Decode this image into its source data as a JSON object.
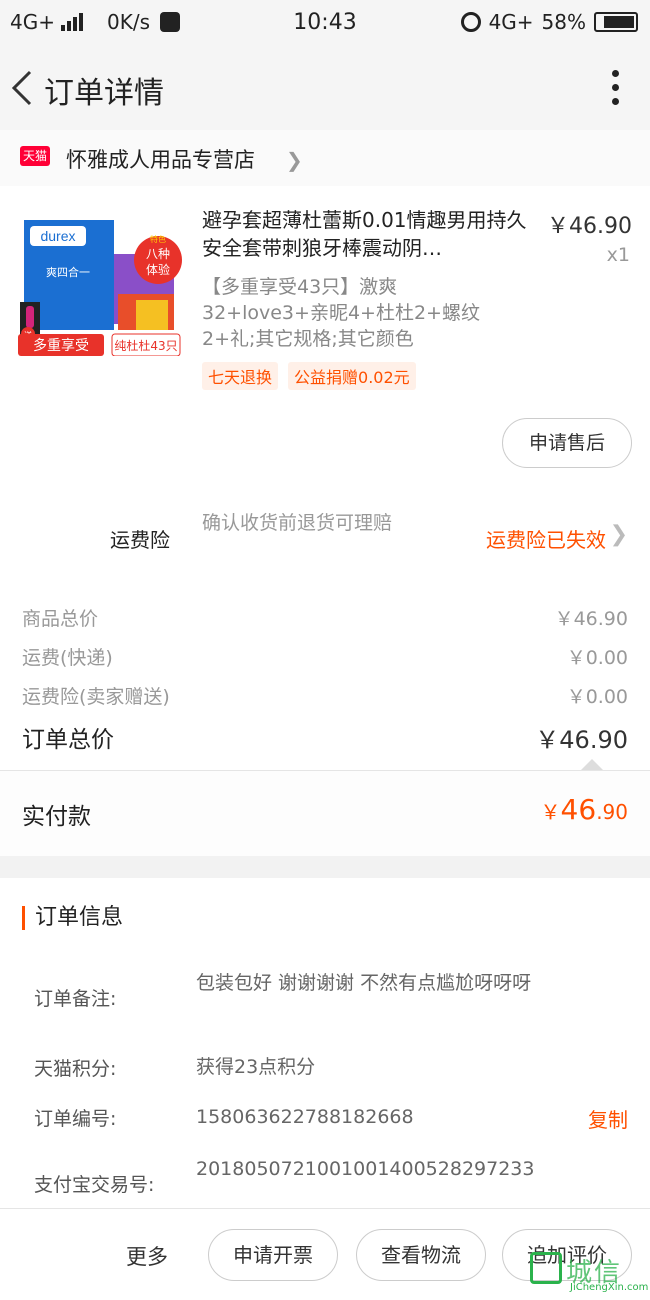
{
  "statusbar": {
    "network_left": "4G+",
    "speed": "0K/s",
    "time": "10:43",
    "network_right": "4G+",
    "battery": "58%"
  },
  "nav": {
    "title": "订单详情"
  },
  "shop": {
    "badge": "天猫",
    "name": "怀雅成人用品专营店"
  },
  "product": {
    "title": "避孕套超薄杜蕾斯0.01情趣男用持久安全套带刺狼牙棒震动阴…",
    "price": "￥46.90",
    "qty": "x1",
    "sku": "【多重享受43只】激爽32+love3+亲昵4+杜杜2+螺纹2+礼;其它规格;其它颜色",
    "tags": [
      "七天退换",
      "公益捐赠0.02元"
    ],
    "image": {
      "brand": "durex",
      "subtitle": "爽四合一",
      "badge_line1": "八种",
      "badge_line2": "体验",
      "badge_top": "特色",
      "banner_left": "多重享受",
      "banner_right": "纯杜杜43只",
      "gift": "送"
    },
    "aftersale_label": "申请售后"
  },
  "insurance": {
    "label": "运费险",
    "desc": "确认收货前退货可理赔",
    "status": "运费险已失效"
  },
  "totals": {
    "goods_label": "商品总价",
    "goods_value": "￥46.90",
    "shipping_label": "运费(快递)",
    "shipping_value": "￥0.00",
    "ins_label": "运费险(卖家赠送)",
    "ins_value": "￥0.00",
    "order_label": "订单总价",
    "order_value": "￥46.90"
  },
  "paid": {
    "label": "实付款",
    "currency": "￥",
    "int": "46",
    "dec": ".90"
  },
  "order_info": {
    "title": "订单信息",
    "rows": [
      {
        "key": "订单备注:",
        "value": "包装包好 谢谢谢谢 不然有点尴尬呀呀呀"
      },
      {
        "key": "天猫积分:",
        "value": "获得23点积分"
      },
      {
        "key": "订单编号:",
        "value": "158063622788182668",
        "action": "复制"
      },
      {
        "key": "支付宝交易号:",
        "value": "2018050721001001400528297233"
      }
    ]
  },
  "bottombar": {
    "more": "更多",
    "invoice": "申请开票",
    "logistics": "查看物流",
    "review": "追加评价"
  },
  "watermark": {
    "text": "城信",
    "sub": "JiChengXin.com"
  },
  "colors": {
    "accent": "#ff5000",
    "tmall": "#ff0036"
  }
}
